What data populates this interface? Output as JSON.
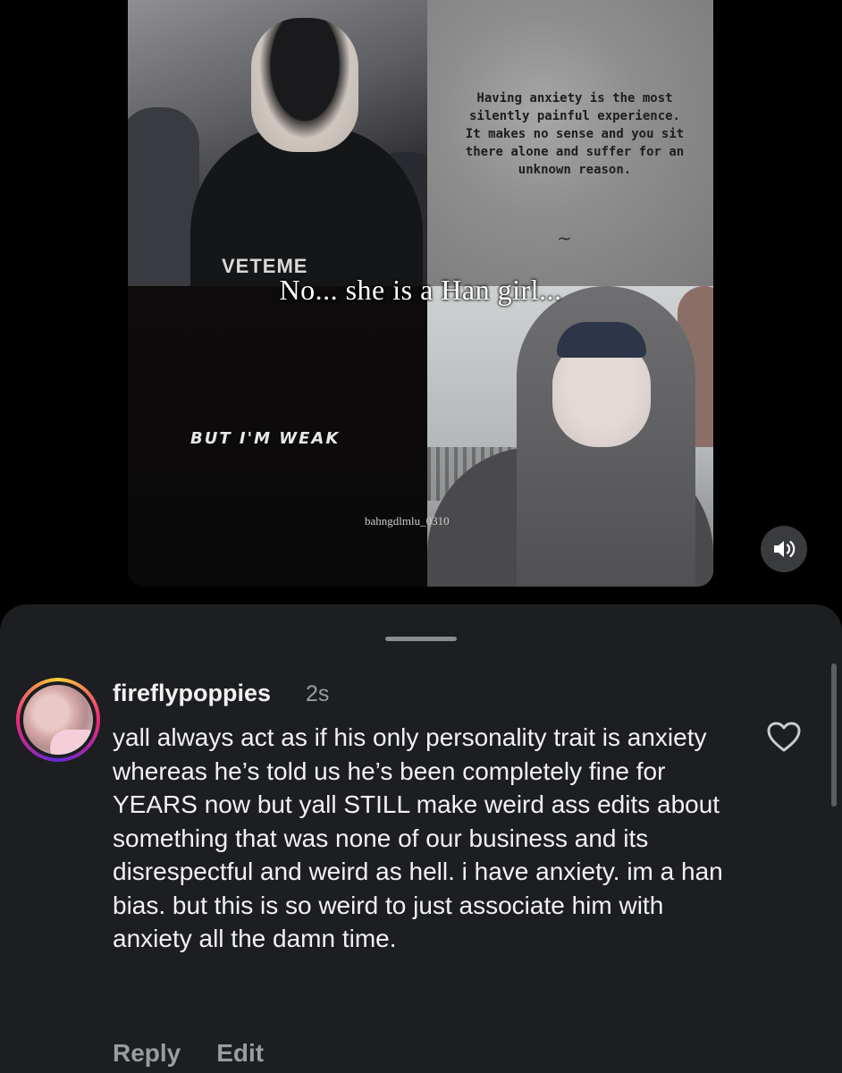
{
  "video": {
    "quote": "Having anxiety is the most silently painful experience. It makes no sense and you sit there alone and suffer for an unknown reason.",
    "tilde": "~",
    "shirt_text": "VETEME",
    "subtitle": "No... she is a Han girl...",
    "weak_text": "BUT I'M WEAK",
    "watermark": "bahngdlmlu_0310",
    "sound_icon": "speaker-on-icon"
  },
  "comment": {
    "username": "fireflypoppies",
    "time": "2s",
    "text": "yall always act as if his only personality trait is anxiety whereas he’s told us he’s been completely fine for YEARS now but yall STILL make weird ass edits about something that was none of our business and its disrespectful and weird as hell. i have anxiety. im a han bias. but this is so weird to just associate him with anxiety all the damn time.",
    "like_icon": "heart-outline-icon",
    "actions": {
      "reply": "Reply",
      "edit": "Edit"
    }
  }
}
